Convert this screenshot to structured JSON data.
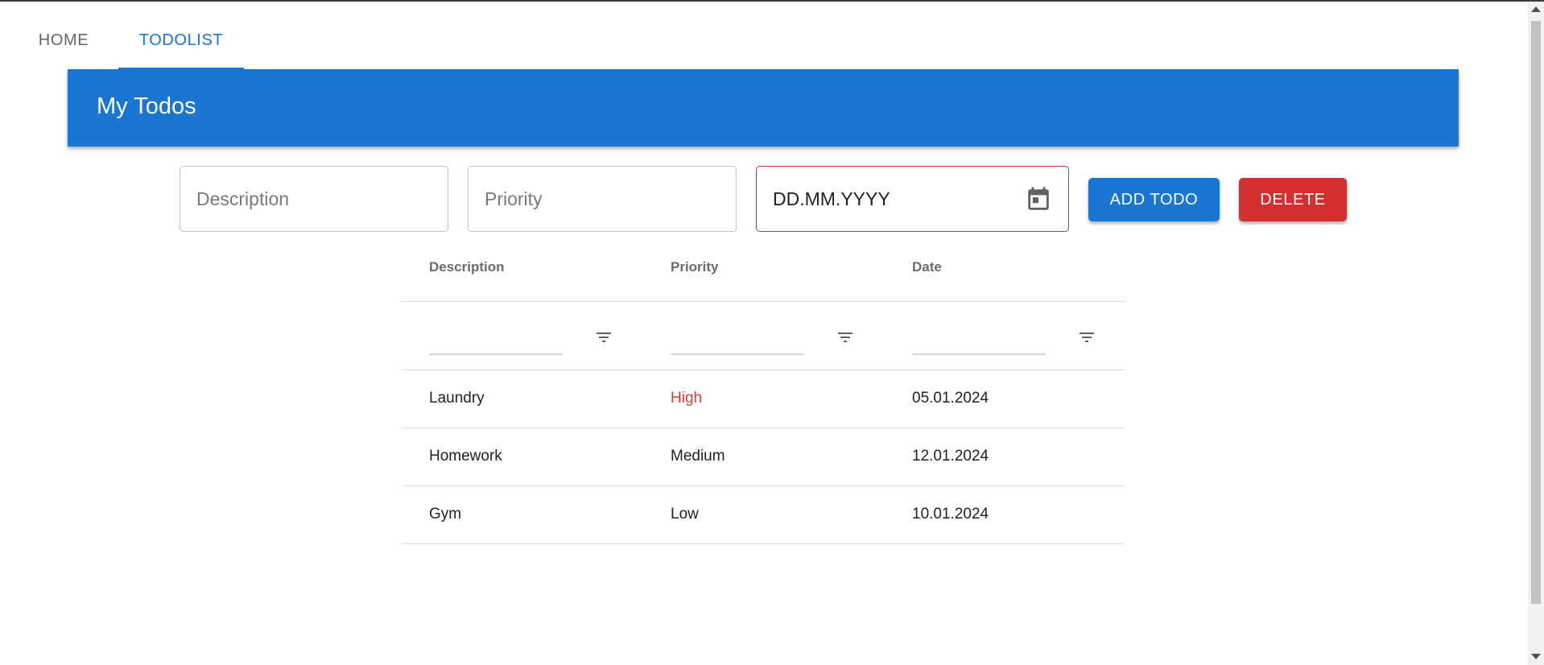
{
  "nav": {
    "tabs": [
      {
        "label": "HOME"
      },
      {
        "label": "TODOLIST"
      }
    ]
  },
  "appbar": {
    "title": "My Todos"
  },
  "form": {
    "description_placeholder": "Description",
    "priority_placeholder": "Priority",
    "date_placeholder": "DD.MM.YYYY",
    "add_label": "ADD TODO",
    "delete_label": "DELETE"
  },
  "grid": {
    "columns": [
      "Description",
      "Priority",
      "Date"
    ],
    "rows": [
      {
        "description": "Laundry",
        "priority": "High",
        "date": "05.01.2024"
      },
      {
        "description": "Homework",
        "priority": "Medium",
        "date": "12.01.2024"
      },
      {
        "description": "Gym",
        "priority": "Low",
        "date": "10.01.2024"
      }
    ]
  },
  "colors": {
    "primary": "#1976d2",
    "danger": "#d32f2f",
    "high_priority_text": "#e53935"
  },
  "icons": {
    "date_picker": "calendar-icon",
    "column_filter": "filter-icon"
  }
}
